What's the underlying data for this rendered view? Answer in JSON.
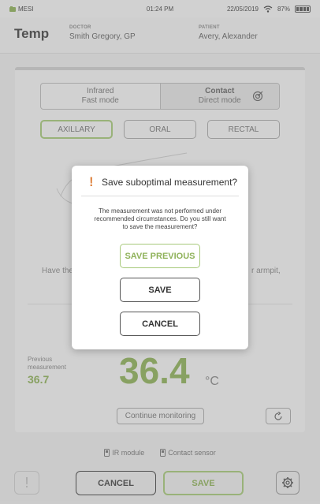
{
  "status_bar": {
    "carrier": "MESI",
    "time": "01:24 PM",
    "date": "22/05/2019",
    "battery": "87%"
  },
  "header": {
    "title": "Temp",
    "doctor_label": "DOCTOR",
    "doctor_name": "Smith Gregory, GP",
    "patient_label": "PATIENT",
    "patient_name": "Avery, Alexander"
  },
  "mode_toggle": {
    "infrared_title": "Infrared",
    "infrared_sub": "Fast mode",
    "contact_title": "Contact",
    "contact_sub": "Direct mode"
  },
  "sites": [
    "AXILLARY",
    "ORAL",
    "RECTAL"
  ],
  "instruction": {
    "left": "Have the",
    "right": "r armpit,"
  },
  "measurement": {
    "previous_label": "Previous measurement",
    "previous_value": "36.7",
    "current_value": "36.4",
    "unit": "°C",
    "monitor_label": "Continue monitoring"
  },
  "sensors": {
    "ir": "IR module",
    "contact": "Contact sensor"
  },
  "footer": {
    "cancel": "CANCEL",
    "save": "SAVE"
  },
  "dialog": {
    "title": "Save suboptimal measurement?",
    "message": "The measurement was not performed under recommended circumstances. Do you still want to save the measurement?",
    "save_previous": "SAVE PREVIOUS",
    "save": "SAVE",
    "cancel": "CANCEL"
  }
}
